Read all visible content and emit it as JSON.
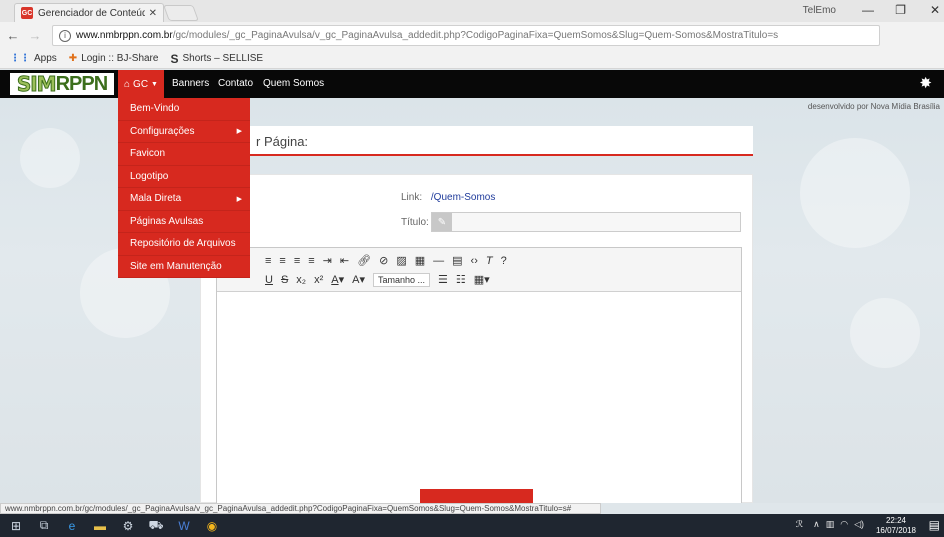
{
  "browser": {
    "tab_title": "Gerenciador de Conteúdo",
    "tab_favicon": "GC",
    "window_user": "TelEmo",
    "url_host": "www.nmbrppn.com.br",
    "url_path": "/gc/modules/_gc_PaginaAvulsa/v_gc_PaginaAvulsa_addedit.php?CodigoPaginaFixa=QuemSomos&Slug=Quem-Somos&MostraTitulo=s"
  },
  "bookmarks": [
    {
      "label": "Apps"
    },
    {
      "label": "Login :: BJ-Share"
    },
    {
      "label": "Shorts – SELLISE"
    }
  ],
  "site": {
    "logo_part1": "SIM",
    "logo_part2": "RPPN",
    "nav": {
      "gc": "GC",
      "banners": "Banners",
      "contato": "Contato",
      "quem_somos": "Quem Somos"
    },
    "credit": "desenvolvido por Nova Mídia Brasília"
  },
  "dropdown": [
    {
      "label": "Bem-Vindo",
      "submenu": false
    },
    {
      "label": "Configurações",
      "submenu": true
    },
    {
      "label": "Favicon",
      "submenu": false
    },
    {
      "label": "Logotipo",
      "submenu": false
    },
    {
      "label": "Mala Direta",
      "submenu": true
    },
    {
      "label": "Páginas Avulsas",
      "submenu": false
    },
    {
      "label": "Repositório de Arquivos",
      "submenu": false
    },
    {
      "label": "Site em Manutenção",
      "submenu": false
    }
  ],
  "form": {
    "heading": "r Página:",
    "link_label": "Link:",
    "link_value": "/Quem-Somos",
    "title_label": "Título:",
    "toolbar_size": "Tamanho ..."
  },
  "status_url": "www.nmbrppn.com.br/gc/modules/_gc_PaginaAvulsa/v_gc_PaginaAvulsa_addedit.php?CodigoPaginaFixa=QuemSomos&Slug=Quem-Somos&MostraTitulo=s#",
  "taskbar": {
    "time": "22:24",
    "date": "16/07/2018"
  },
  "colors": {
    "accent": "#d7291f",
    "nav_bg": "#080808",
    "link": "#1f3b9b"
  }
}
